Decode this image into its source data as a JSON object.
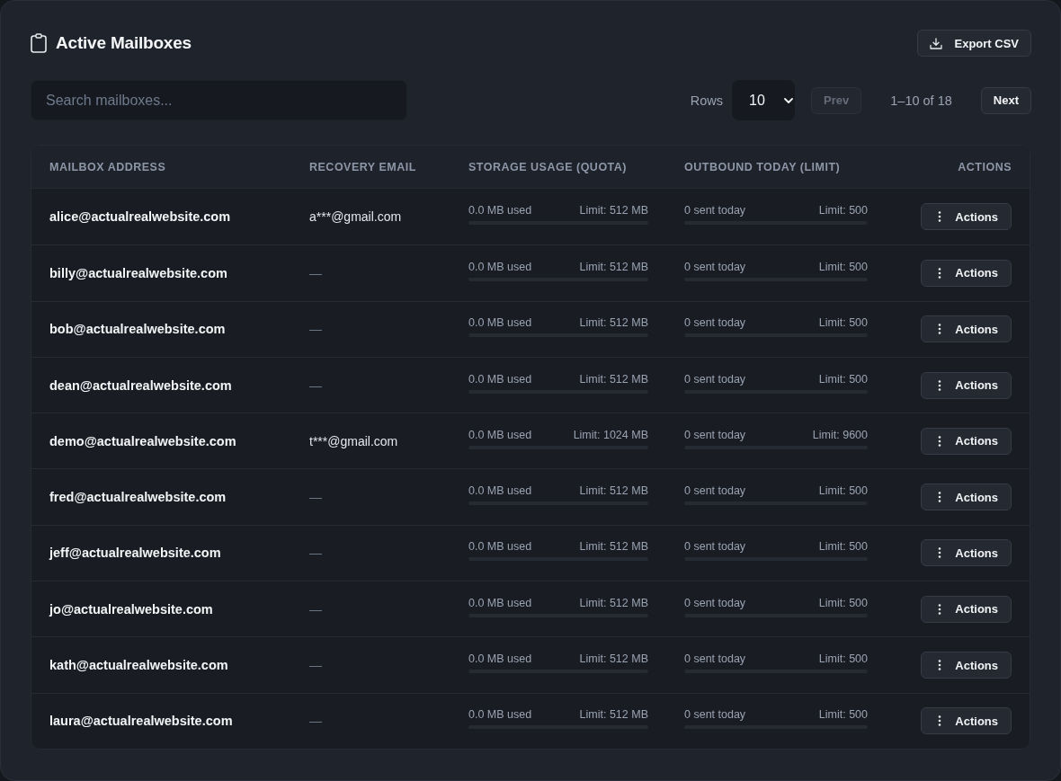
{
  "header": {
    "title": "Active Mailboxes",
    "export_button": "Export CSV"
  },
  "search": {
    "placeholder": "Search mailboxes..."
  },
  "pagination": {
    "rows_label": "Rows",
    "rows_value": "10",
    "prev": {
      "label": "Prev",
      "disabled": true
    },
    "range": "1–10 of 18",
    "next": {
      "label": "Next",
      "disabled": false
    }
  },
  "table": {
    "columns": [
      "MAILBOX ADDRESS",
      "RECOVERY EMAIL",
      "STORAGE USAGE (QUOTA)",
      "OUTBOUND TODAY (LIMIT)",
      "ACTIONS"
    ],
    "rows": [
      {
        "address": "alice@actualrealwebsite.com",
        "recovery": {
          "kind": "email",
          "text": "a***@gmail.com"
        },
        "storage": {
          "used": "0.0 MB used",
          "limit": "Limit: 512 MB",
          "level": 0
        },
        "outbound": {
          "sent": "0 sent today",
          "limit": "Limit: 500",
          "level": 0
        },
        "action": "Actions"
      },
      {
        "address": "billy@actualrealwebsite.com",
        "recovery": {
          "kind": "empty",
          "text": "—"
        },
        "storage": {
          "used": "0.0 MB used",
          "limit": "Limit: 512 MB",
          "level": 0
        },
        "outbound": {
          "sent": "0 sent today",
          "limit": "Limit: 500",
          "level": 0
        },
        "action": "Actions"
      },
      {
        "address": "bob@actualrealwebsite.com",
        "recovery": {
          "kind": "empty",
          "text": "—"
        },
        "storage": {
          "used": "0.0 MB used",
          "limit": "Limit: 512 MB",
          "level": 0
        },
        "outbound": {
          "sent": "0 sent today",
          "limit": "Limit: 500",
          "level": 0
        },
        "action": "Actions"
      },
      {
        "address": "dean@actualrealwebsite.com",
        "recovery": {
          "kind": "empty",
          "text": "—"
        },
        "storage": {
          "used": "0.0 MB used",
          "limit": "Limit: 512 MB",
          "level": 0
        },
        "outbound": {
          "sent": "0 sent today",
          "limit": "Limit: 500",
          "level": 0
        },
        "action": "Actions"
      },
      {
        "address": "demo@actualrealwebsite.com",
        "recovery": {
          "kind": "email",
          "text": "t***@gmail.com"
        },
        "storage": {
          "used": "0.0 MB used",
          "limit": "Limit: 1024 MB",
          "level": 0
        },
        "outbound": {
          "sent": "0 sent today",
          "limit": "Limit: 9600",
          "level": 0
        },
        "action": "Actions"
      },
      {
        "address": "fred@actualrealwebsite.com",
        "recovery": {
          "kind": "empty",
          "text": "—"
        },
        "storage": {
          "used": "0.0 MB used",
          "limit": "Limit: 512 MB",
          "level": 0
        },
        "outbound": {
          "sent": "0 sent today",
          "limit": "Limit: 500",
          "level": 0
        },
        "action": "Actions"
      },
      {
        "address": "jeff@actualrealwebsite.com",
        "recovery": {
          "kind": "empty",
          "text": "—"
        },
        "storage": {
          "used": "0.0 MB used",
          "limit": "Limit: 512 MB",
          "level": 0
        },
        "outbound": {
          "sent": "0 sent today",
          "limit": "Limit: 500",
          "level": 0
        },
        "action": "Actions"
      },
      {
        "address": "jo@actualrealwebsite.com",
        "recovery": {
          "kind": "empty",
          "text": "—"
        },
        "storage": {
          "used": "0.0 MB used",
          "limit": "Limit: 512 MB",
          "level": 0
        },
        "outbound": {
          "sent": "0 sent today",
          "limit": "Limit: 500",
          "level": 0
        },
        "action": "Actions"
      },
      {
        "address": "kath@actualrealwebsite.com",
        "recovery": {
          "kind": "empty",
          "text": "—"
        },
        "storage": {
          "used": "0.0 MB used",
          "limit": "Limit: 512 MB",
          "level": 0
        },
        "outbound": {
          "sent": "0 sent today",
          "limit": "Limit: 500",
          "level": 0
        },
        "action": "Actions"
      },
      {
        "address": "laura@actualrealwebsite.com",
        "recovery": {
          "kind": "empty",
          "text": "—"
        },
        "storage": {
          "used": "0.0 MB used",
          "limit": "Limit: 512 MB",
          "level": 0
        },
        "outbound": {
          "sent": "0 sent today",
          "limit": "Limit: 500",
          "level": 0
        },
        "action": "Actions"
      }
    ]
  }
}
